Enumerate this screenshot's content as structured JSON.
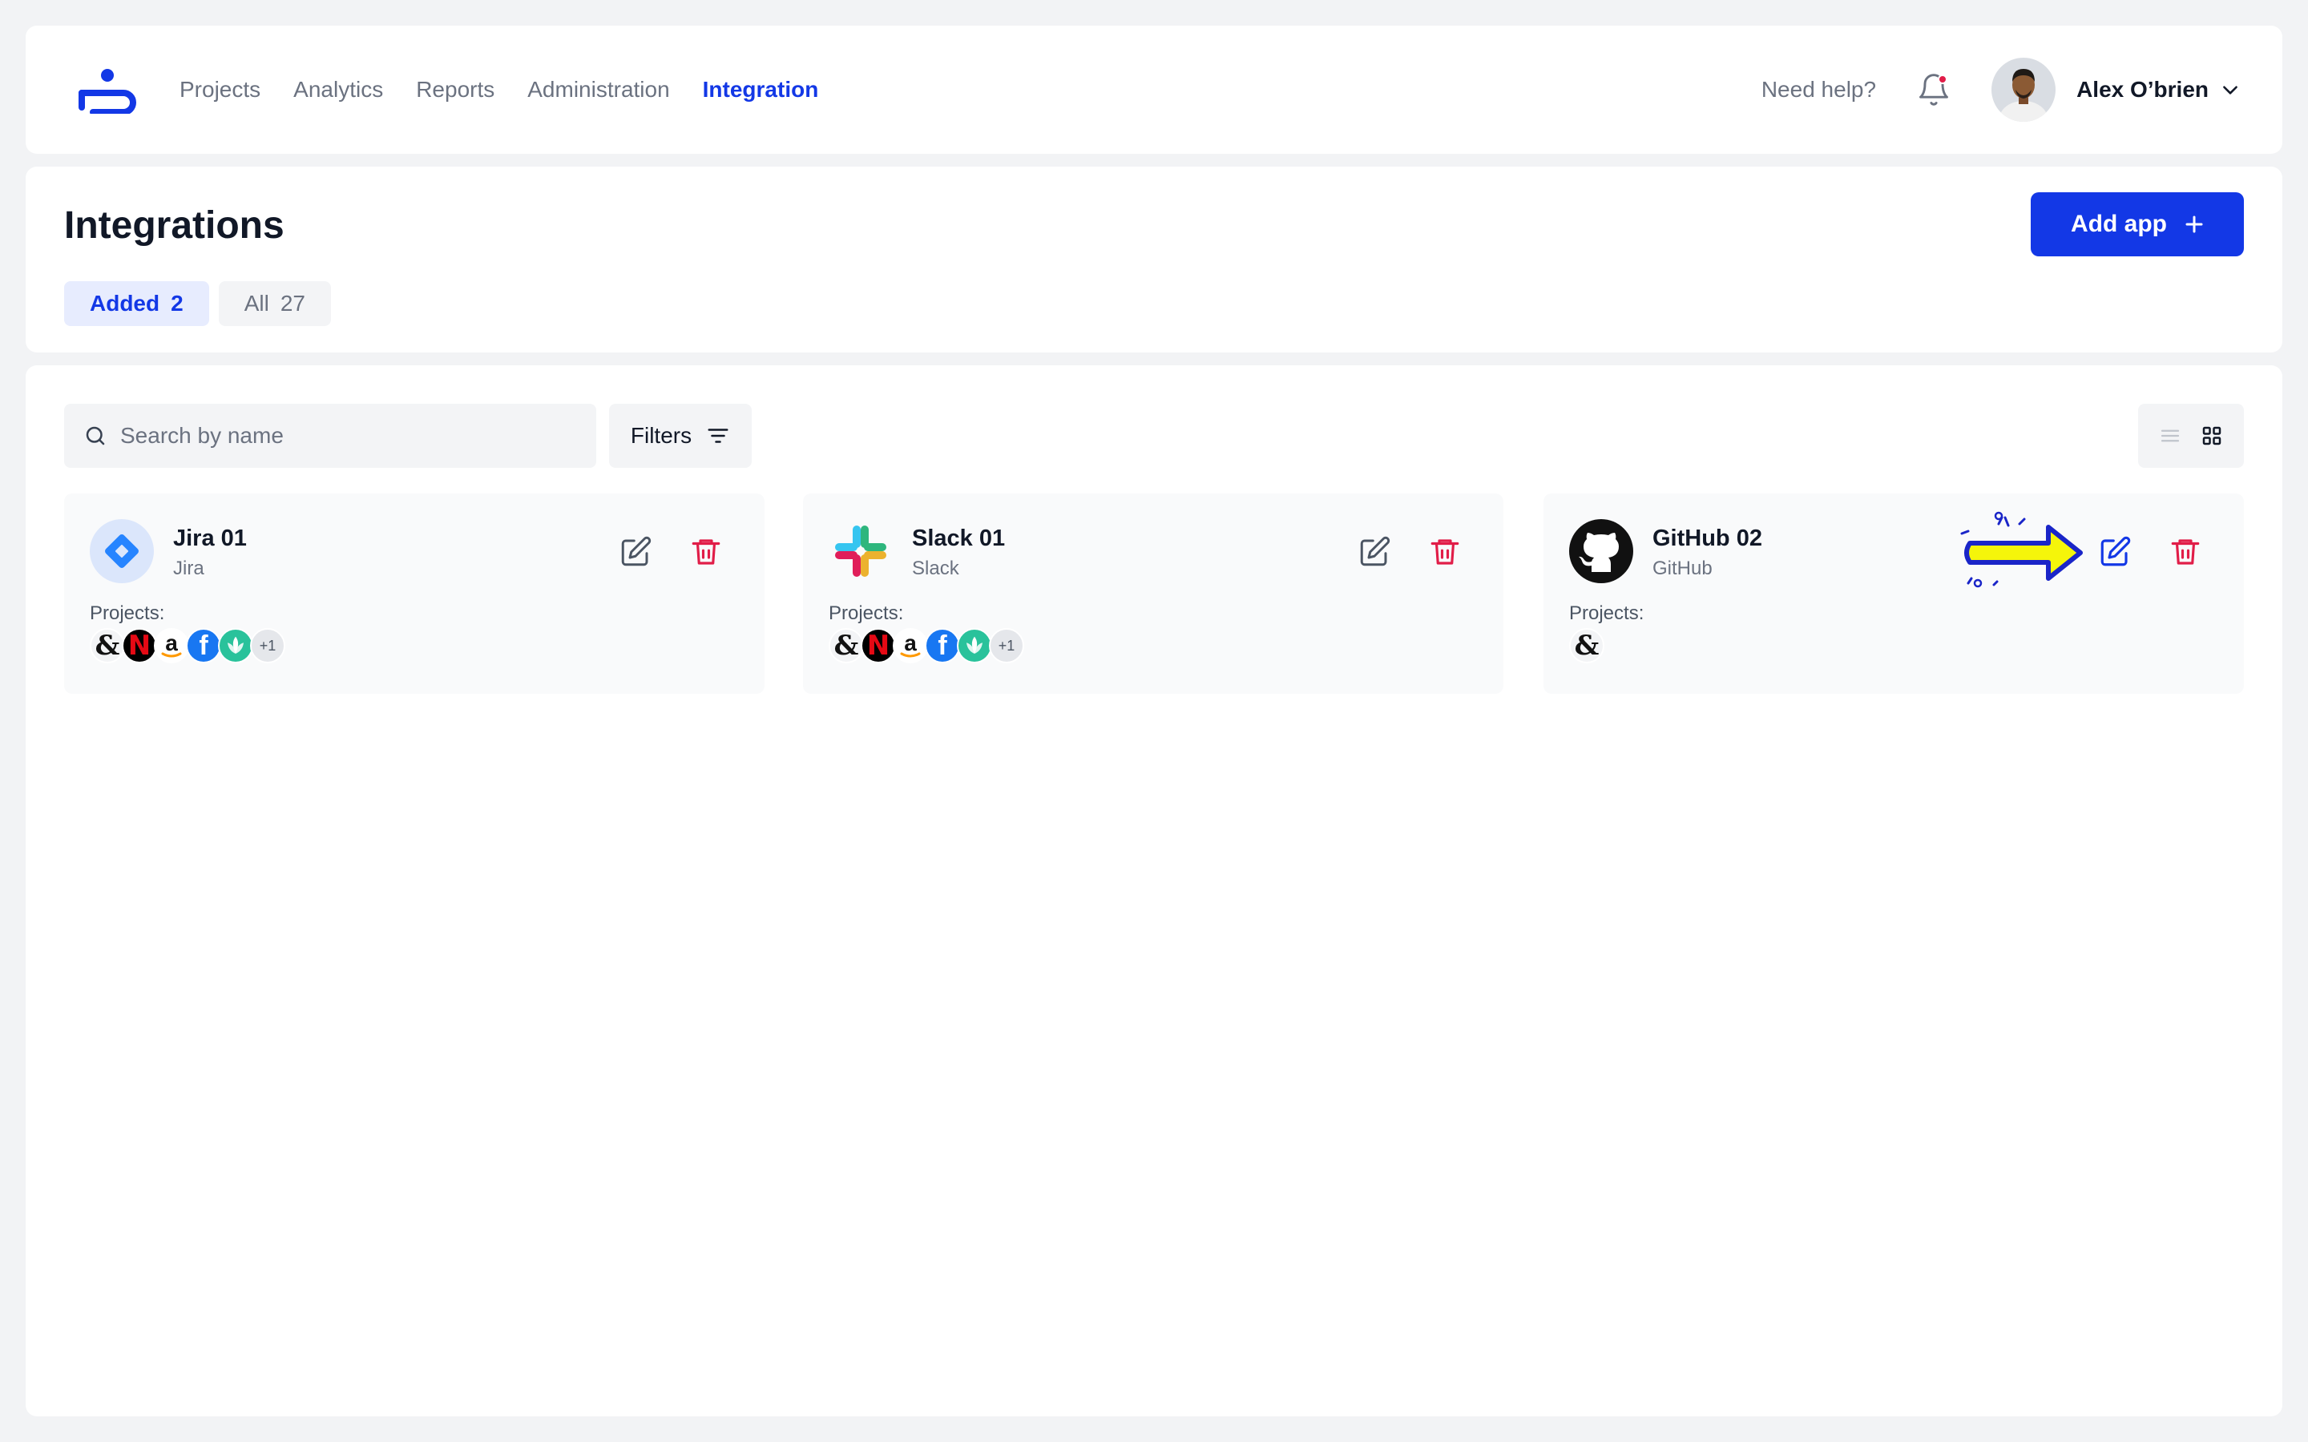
{
  "colors": {
    "accent": "#1338e6",
    "danger": "#e11d48",
    "background": "#f2f3f5"
  },
  "header": {
    "logo": "brand-logo-icon",
    "nav": [
      {
        "label": "Projects",
        "active": false
      },
      {
        "label": "Analytics",
        "active": false
      },
      {
        "label": "Reports",
        "active": false
      },
      {
        "label": "Administration",
        "active": false
      },
      {
        "label": "Integration",
        "active": true
      }
    ],
    "help": "Need help?",
    "notification_icon": "bell-icon",
    "user": {
      "name": "Alex O’brien",
      "menu_icon": "chevron-down-icon"
    }
  },
  "page": {
    "title": "Integrations",
    "add_button": "Add app",
    "tabs": [
      {
        "label": "Added",
        "count": "2",
        "active": true
      },
      {
        "label": "All",
        "count": "27",
        "active": false
      }
    ]
  },
  "toolbar": {
    "search_placeholder": "Search by name",
    "filters_label": "Filters",
    "view_mode": "grid"
  },
  "cards": [
    {
      "name": "Jira 01",
      "type": "Jira",
      "logo": "jira-icon",
      "projects_label": "Projects:",
      "projects": [
        "&",
        "N",
        "a",
        "f",
        "leaf"
      ],
      "more": "+1"
    },
    {
      "name": "Slack 01",
      "type": "Slack",
      "logo": "slack-icon",
      "projects_label": "Projects:",
      "projects": [
        "&",
        "N",
        "a",
        "f",
        "leaf"
      ],
      "more": "+1"
    },
    {
      "name": "GitHub 02",
      "type": "GitHub",
      "logo": "github-icon",
      "projects_label": "Projects:",
      "projects": [
        "&"
      ],
      "more": ""
    }
  ]
}
